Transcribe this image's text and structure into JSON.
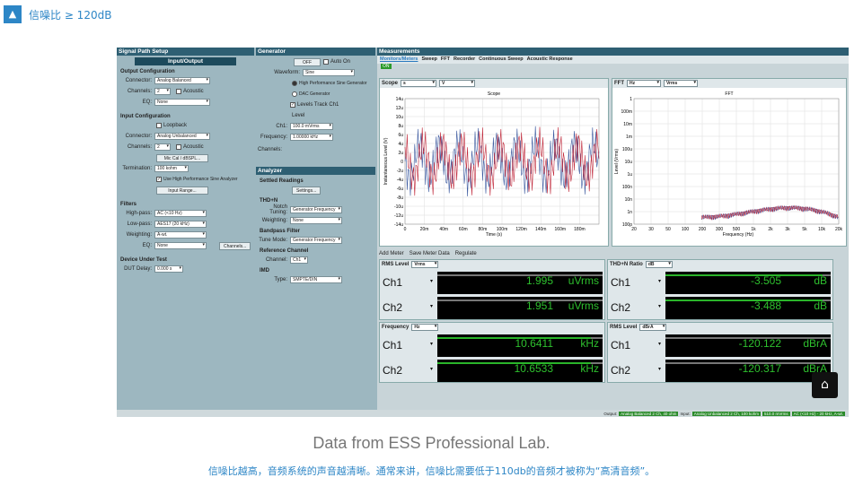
{
  "header": {
    "toggle_icon": "chevron-up-icon",
    "title": "信噪比 ≥ 120dB"
  },
  "signal_path": {
    "title": "Signal Path Setup",
    "tab": "Input/Output",
    "output_config": "Output Configuration",
    "connector_label": "Connector:",
    "out_connector": "Analog Balanced",
    "channels_label": "Channels:",
    "out_channels": "2",
    "acoustic": "Acoustic",
    "eq_label": "EQ:",
    "eq_value": "None",
    "input_config": "Input Configuration",
    "loopback": "Loopback",
    "in_connector": "Analog Unbalanced",
    "in_channels": "2",
    "mic_cal": "Mic Cal / dBSPL...",
    "termination_label": "Termination:",
    "termination": "100 kohm",
    "hp_sine": "Use High Performance Sine Analyzer",
    "input_range": "Input Range...",
    "filters": "Filters",
    "highpass_label": "High-pass:",
    "highpass": "AC (<10 Hz)",
    "lowpass_label": "Low-pass:",
    "lowpass": "AES17 (20 kHz)",
    "weighting_label": "Weighting:",
    "weighting": "A-wt.",
    "eq2": "None",
    "channels_btn": "Channels...",
    "dut": "Device Under Test",
    "dut_delay_label": "DUT Delay:",
    "dut_delay": "0.000 s"
  },
  "generator": {
    "title": "Generator",
    "off": "OFF",
    "auto_on": "Auto On",
    "waveform_label": "Waveform:",
    "waveform": "Sine",
    "hp_sine_gen": "High Performance Sine Generator",
    "dac_gen": "DAC Generator",
    "levels_track": "Levels Track Ch1",
    "level": "Level",
    "ch1_label": "Ch1:",
    "ch1": "100.0 mVrms",
    "freq_label": "Frequency:",
    "freq": "1.00000 kHz",
    "channels": "Channels:"
  },
  "analyzer": {
    "title": "Analyzer",
    "settled": "Settled Readings",
    "settings": "Settings...",
    "thdn": "THD+N",
    "notch_label": "Notch Tuning:",
    "notch": "Generator Frequency",
    "weighting_label": "Weighting:",
    "weighting": "None",
    "bandpass": "Bandpass Filter",
    "tune_label": "Tune Mode:",
    "tune": "Generator Frequency",
    "ref": "Reference Channel",
    "ref_channel_label": "Channel:",
    "ref_channel": "Ch1",
    "imd": "IMD",
    "type_label": "Type:",
    "type": "SMPTE/DIN"
  },
  "measurements": {
    "title": "Measurements",
    "tabs": [
      "Monitors/Meters",
      "Sweep",
      "FFT",
      "Recorder",
      "Continuous Sweep",
      "Acoustic Response"
    ],
    "on": "ON",
    "scope": {
      "title": "Scope",
      "x": "s",
      "y": "V",
      "chart_title": "Scope",
      "ylabel": "Instantaneous Level (V)",
      "xlabel": "Time (s)",
      "yticks": [
        "14u",
        "12u",
        "10u",
        "8u",
        "6u",
        "4u",
        "2u",
        "0",
        "-2u",
        "-4u",
        "-6u",
        "-8u",
        "-10u",
        "-12u",
        "-14u"
      ],
      "xticks": [
        "0",
        "20m",
        "40m",
        "60m",
        "80m",
        "100m",
        "120m",
        "140m",
        "160m",
        "180m"
      ]
    },
    "fft": {
      "title": "FFT",
      "x": "Hz",
      "y": "Vrms",
      "chart_title": "FFT",
      "ylabel": "Level (Vrms)",
      "xlabel": "Frequency (Hz)",
      "yticks": [
        "1",
        "100m",
        "10m",
        "1m",
        "100u",
        "10u",
        "1u",
        "100n",
        "10n",
        "1n",
        "100p"
      ],
      "xticks": [
        "20",
        "30",
        "50",
        "100",
        "200",
        "300",
        "500",
        "1k",
        "2k",
        "3k",
        "5k",
        "10k",
        "20k"
      ]
    },
    "toolbar": {
      "add_meter": "Add Meter",
      "save": "Save Meter Data",
      "regulate": "Regulate"
    },
    "meters": [
      {
        "title": "RMS Level",
        "unit_sel": "Vrms",
        "rows": [
          {
            "ch": "Ch1",
            "val": "1.995",
            "unit": "uVrms",
            "fill": 0.0
          },
          {
            "ch": "Ch2",
            "val": "1.951",
            "unit": "uVrms",
            "fill": 0.0
          }
        ]
      },
      {
        "title": "THD+N Ratio",
        "unit_sel": "dB",
        "rows": [
          {
            "ch": "Ch1",
            "val": "-3.505",
            "unit": "dB",
            "fill": 0.95
          },
          {
            "ch": "Ch2",
            "val": "-3.488",
            "unit": "dB",
            "fill": 0.95
          }
        ]
      },
      {
        "title": "Frequency",
        "unit_sel": "Hz",
        "rows": [
          {
            "ch": "Ch1",
            "val": "10.6411",
            "unit": "kHz",
            "fill": 0.93
          },
          {
            "ch": "Ch2",
            "val": "10.6533",
            "unit": "kHz",
            "fill": 0.93
          }
        ]
      },
      {
        "title": "RMS Level",
        "unit_sel": "dBrA",
        "rows": [
          {
            "ch": "Ch1",
            "val": "-120.122",
            "unit": "dBrA",
            "fill": 0.0
          },
          {
            "ch": "Ch2",
            "val": "-120.317",
            "unit": "dBrA",
            "fill": 0.0
          }
        ]
      }
    ]
  },
  "status": {
    "output_label": "Output:",
    "output": "Analog Balanced 2 Ch, 40 ohm",
    "input_label": "Input:",
    "input": "Analog Unbalanced 2 Ch, 100 kohm",
    "s1": "510.0 mVrms",
    "s2": "AC (<10 Hz) - 20 kHz, A-wt."
  },
  "captions": {
    "source": "Data from ESS Professional Lab.",
    "desc": "信噪比越高，音频系统的声音越清晰。通常来讲，信噪比需要低于110db的音频才被称为“高清音频”。"
  },
  "logo_icon": "audio-logo-icon"
}
